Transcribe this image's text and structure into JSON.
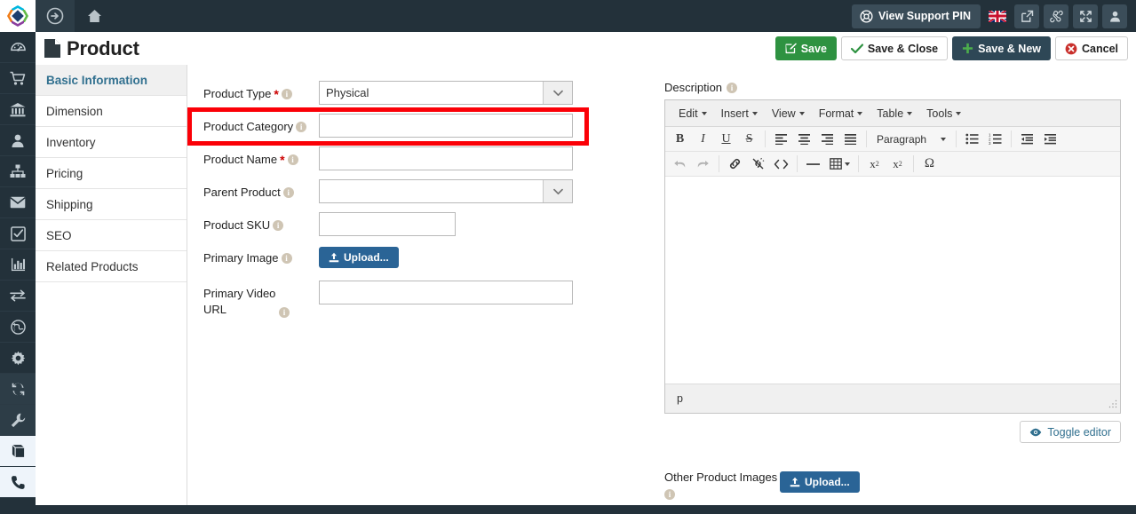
{
  "topbar": {
    "logo_icon": "app-diamond-logo",
    "forward_icon": "arrow-circle-right-icon",
    "home_icon": "home-icon",
    "support_pin_label": "View Support PIN",
    "support_pin_icon": "lifebuoy-icon",
    "flag_icon": "uk-flag-icon",
    "external_link_icon": "external-link-icon",
    "joomla_icon": "joomla-icon",
    "fullscreen_icon": "arrows-alt-icon",
    "user_icon": "user-icon",
    "background_color": "#23313a"
  },
  "pagehead": {
    "title": "Product",
    "doc_icon": "file-icon",
    "buttons": [
      {
        "label": "Save",
        "icon": "edit-square-icon",
        "color": "#2e9241"
      },
      {
        "label": "Save & Close",
        "icon": "check-icon",
        "color": "#ffffff"
      },
      {
        "label": "Save & New",
        "icon": "plus-icon",
        "color": "#2e4756"
      },
      {
        "label": "Cancel",
        "icon": "times-circle-icon",
        "color": "#ffffff"
      }
    ]
  },
  "rail": {
    "items": [
      {
        "icon": "dashboard-icon",
        "state": "normal"
      },
      {
        "icon": "shopping-cart-icon",
        "state": "normal"
      },
      {
        "icon": "bank-icon",
        "state": "normal"
      },
      {
        "icon": "user-icon",
        "state": "normal"
      },
      {
        "icon": "sitemap-icon",
        "state": "normal"
      },
      {
        "icon": "envelope-icon",
        "state": "normal"
      },
      {
        "icon": "check-square-icon",
        "state": "normal"
      },
      {
        "icon": "bar-chart-icon",
        "state": "normal"
      },
      {
        "icon": "exchange-icon",
        "state": "normal"
      },
      {
        "icon": "globe-icon",
        "state": "normal"
      },
      {
        "icon": "gear-icon",
        "state": "normal"
      },
      {
        "icon": "refresh-icon",
        "state": "shade"
      },
      {
        "icon": "wrench-icon",
        "state": "shade"
      },
      {
        "icon": "book-icon",
        "state": "light"
      },
      {
        "icon": "phone-icon",
        "state": "light"
      }
    ]
  },
  "leftmenu": {
    "items": [
      {
        "label": "Basic Information",
        "active": true
      },
      {
        "label": "Dimension",
        "active": false
      },
      {
        "label": "Inventory",
        "active": false
      },
      {
        "label": "Pricing",
        "active": false
      },
      {
        "label": "Shipping",
        "active": false
      },
      {
        "label": "SEO",
        "active": false
      },
      {
        "label": "Related Products",
        "active": false
      }
    ]
  },
  "form": {
    "product_type": {
      "label": "Product Type",
      "required": true,
      "value": "Physical",
      "type": "select"
    },
    "product_category": {
      "label": "Product Category",
      "required": false,
      "value": "",
      "type": "text",
      "highlighted": true
    },
    "product_name": {
      "label": "Product Name",
      "required": true,
      "value": "",
      "type": "text"
    },
    "parent_product": {
      "label": "Parent Product",
      "required": false,
      "value": "",
      "type": "select"
    },
    "product_sku": {
      "label": "Product SKU",
      "required": false,
      "value": "",
      "type": "text"
    },
    "primary_image": {
      "label": "Primary Image",
      "required": false,
      "upload_label": "Upload..."
    },
    "primary_video_url": {
      "label": "Primary Video URL",
      "required": false,
      "value": "",
      "type": "text"
    },
    "info_icon": "info-circle-icon",
    "required_marker": "*"
  },
  "editor": {
    "label": "Description",
    "info_icon": "info-circle-icon",
    "menubar": [
      {
        "label": "Edit"
      },
      {
        "label": "Insert"
      },
      {
        "label": "View"
      },
      {
        "label": "Format"
      },
      {
        "label": "Table"
      },
      {
        "label": "Tools"
      }
    ],
    "toolbar_row1": [
      {
        "icon": "bold-icon",
        "glyph": "B"
      },
      {
        "icon": "italic-icon",
        "glyph": "I"
      },
      {
        "icon": "underline-icon",
        "glyph": "U"
      },
      {
        "icon": "strikethrough-icon",
        "glyph": "S"
      },
      {
        "icon": "align-left-icon"
      },
      {
        "icon": "align-center-icon"
      },
      {
        "icon": "align-right-icon"
      },
      {
        "icon": "align-justify-icon"
      },
      {
        "icon": "paragraph-format-select",
        "label": "Paragraph"
      },
      {
        "icon": "bullet-list-icon"
      },
      {
        "icon": "numbered-list-icon"
      },
      {
        "icon": "outdent-icon"
      },
      {
        "icon": "indent-icon"
      }
    ],
    "toolbar_row2": [
      {
        "icon": "undo-icon",
        "disabled": true
      },
      {
        "icon": "redo-icon",
        "disabled": true
      },
      {
        "icon": "link-icon"
      },
      {
        "icon": "unlink-icon"
      },
      {
        "icon": "source-code-icon"
      },
      {
        "icon": "horizontal-rule-icon"
      },
      {
        "icon": "table-icon"
      },
      {
        "icon": "subscript-icon"
      },
      {
        "icon": "superscript-icon"
      },
      {
        "icon": "special-character-icon",
        "glyph": "Ω"
      }
    ],
    "paragraph_label": "Paragraph",
    "body_content": "",
    "statusbar_path": "p",
    "toggle_label": "Toggle editor",
    "toggle_icon": "eye-icon"
  },
  "other_images": {
    "label": "Other Product Images",
    "upload_label": "Upload...",
    "upload_icon": "upload-icon",
    "info_icon": "info-circle-icon"
  },
  "colors": {
    "navbar": "#23313a",
    "highlight_red": "#fb0007",
    "save_green": "#2e9241",
    "upload_blue": "#2a6496",
    "link_blue": "#31708f"
  }
}
